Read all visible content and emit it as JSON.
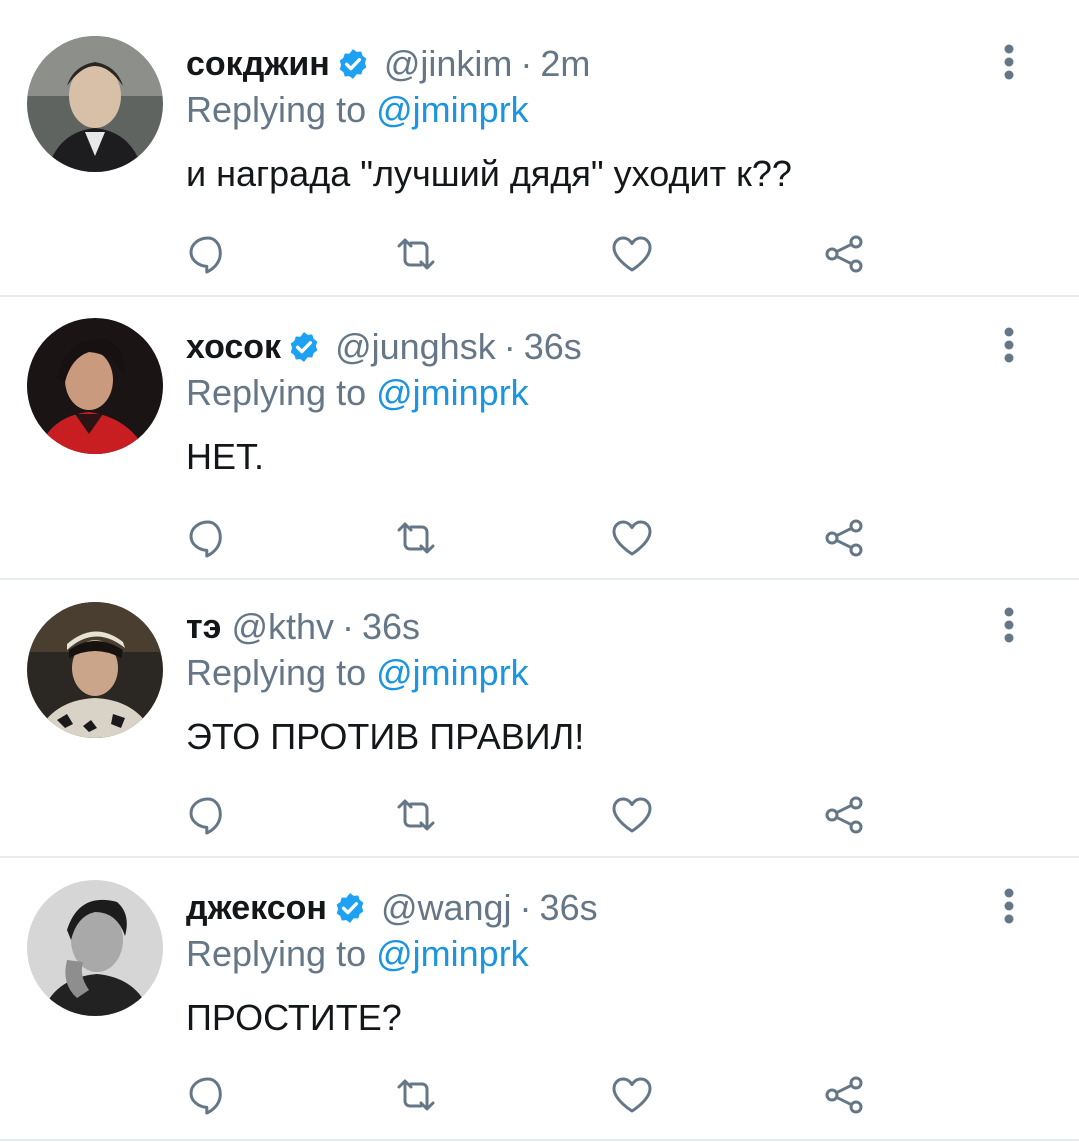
{
  "tweets": [
    {
      "name": "сокджин",
      "verified": true,
      "handle": "@jinkim",
      "time": "2m",
      "replying_label": "Replying to",
      "mention": "@jminprk",
      "text": "и награда \"лучший дядя\" уходит к??"
    },
    {
      "name": "хосок",
      "verified": true,
      "handle": "@junghsk",
      "time": "36s",
      "replying_label": "Replying to",
      "mention": "@jminprk",
      "text": "НЕТ."
    },
    {
      "name": "тэ",
      "verified": false,
      "handle": "@kthv",
      "time": "36s",
      "replying_label": "Replying to",
      "mention": "@jminprk",
      "text": "ЭТО ПРОТИВ ПРАВИЛ!"
    },
    {
      "name": "джексон",
      "verified": true,
      "handle": "@wangj",
      "time": "36s",
      "replying_label": "Replying to",
      "mention": "@jminprk",
      "text": "ПРОСТИТЕ?"
    }
  ],
  "separator_dot": "·",
  "icons": {
    "reply": "reply-icon",
    "retweet": "retweet-icon",
    "like": "heart-icon",
    "share": "share-icon",
    "more": "more-vertical-icon",
    "verified": "verified-badge-icon"
  },
  "colors": {
    "text": "#14171a",
    "secondary": "#657786",
    "link": "#1b95e0",
    "verified": "#1da1f2",
    "separator": "#e6ecf0"
  }
}
